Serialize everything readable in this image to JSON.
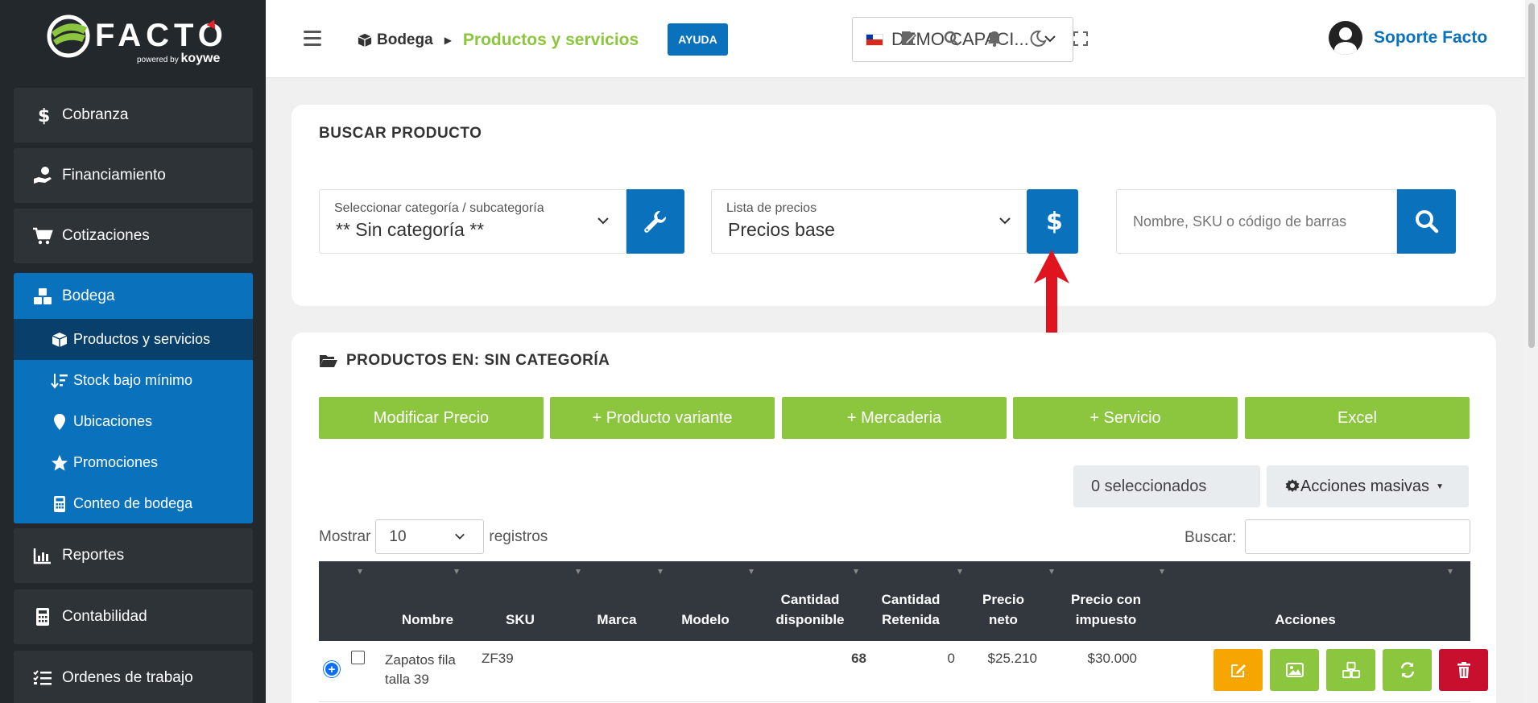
{
  "brand": {
    "name": "FACTO",
    "powered_by": "powered by",
    "partner": "koywe"
  },
  "sidebar": {
    "items": [
      {
        "label": "Cobranza",
        "icon": "dollar-icon"
      },
      {
        "label": "Financiamiento",
        "icon": "hand-money-icon"
      },
      {
        "label": "Cotizaciones",
        "icon": "cart-icon"
      },
      {
        "label": "Reportes",
        "icon": "chart-icon"
      },
      {
        "label": "Contabilidad",
        "icon": "calculator-icon"
      },
      {
        "label": "Ordenes de trabajo",
        "icon": "list-check-icon"
      }
    ],
    "group": {
      "label": "Bodega",
      "icon": "cubes-icon",
      "subitems": [
        {
          "label": "Productos y servicios",
          "icon": "box-icon",
          "active": true
        },
        {
          "label": "Stock bajo mínimo",
          "icon": "sort-down-icon"
        },
        {
          "label": "Ubicaciones",
          "icon": "map-pin-icon"
        },
        {
          "label": "Promociones",
          "icon": "star-icon"
        },
        {
          "label": "Conteo de bodega",
          "icon": "calculator-icon"
        }
      ]
    }
  },
  "header": {
    "breadcrumb_root": "Bodega",
    "breadcrumb_current": "Productos y servicios",
    "help_label": "AYUDA",
    "company": "DEMO CAPACI...",
    "user_name": "Soporte Facto"
  },
  "search_card": {
    "title": "BUSCAR PRODUCTO",
    "category_label": "Seleccionar categoría / subcategoría",
    "category_value": "** Sin categoría **",
    "pricelist_label": "Lista de precios",
    "pricelist_value": "Precios base",
    "search_placeholder": "Nombre, SKU o código de barras"
  },
  "products_card": {
    "title": "PRODUCTOS EN: SIN CATEGORÍA",
    "buttons": [
      "Modificar Precio",
      "+ Producto variante",
      "+ Mercaderia",
      "+ Servicio",
      "Excel"
    ],
    "selected_count": "0 seleccionados",
    "mass_actions": "Acciones masivas",
    "show_label": "Mostrar",
    "show_value": "10",
    "records_label": "registros",
    "filter_label": "Buscar:",
    "columns": {
      "name": "Nombre",
      "sku": "SKU",
      "brand": "Marca",
      "model": "Modelo",
      "available": "Cantidad disponible",
      "retained": "Cantidad Retenida",
      "net_price": "Precio neto",
      "tax_price": "Precio con impuesto",
      "actions": "Acciones"
    },
    "rows": [
      {
        "name": "Zapatos fila talla 39",
        "sku": "ZF39",
        "brand": "",
        "model": "",
        "available": "68",
        "retained": "0",
        "net_price": "$25.210",
        "tax_price": "$30.000"
      }
    ]
  },
  "colors": {
    "sidebar_bg": "#23282c",
    "primary_blue": "#0a72bd",
    "accent_green": "#8cc63f",
    "annotation_red": "#e0141e",
    "edit_orange": "#f7a500",
    "delete_red": "#c8102e"
  }
}
